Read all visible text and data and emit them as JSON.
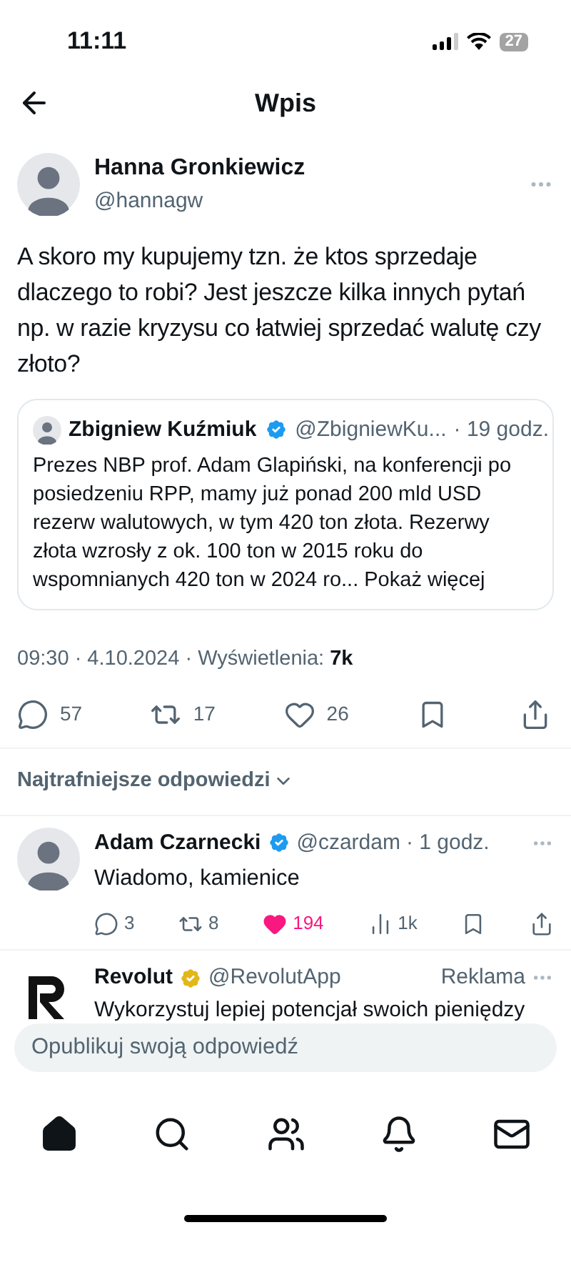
{
  "status_bar": {
    "time": "11:11",
    "battery": "27"
  },
  "header": {
    "title": "Wpis"
  },
  "post": {
    "author": "Hanna Gronkiewicz",
    "handle": "@hannagw",
    "text": "A skoro my kupujemy tzn. że ktos sprzedaje dlaczego to robi? Jest jeszcze kilka innych pytań np. w razie kryzysu co łatwiej sprzedać walutę czy złoto?",
    "quote": {
      "author": "Zbigniew Kuźmiuk",
      "verified": true,
      "handle": "@ZbigniewKu...",
      "time": "· 19 godz.",
      "text": "Prezes NBP prof. Adam Glapiński, na konferencji po posiedzeniu RPP, mamy już ponad 200 mld USD rezerw walutowych, w tym 420 ton złota. Rezerwy złota wzrosły z ok. 100 ton w 2015 roku do wspomnianych 420 ton w 2024 ro...",
      "more": "Pokaż więcej"
    },
    "meta": "09:30 · 4.10.2024 · Wyświetlenia: **7k**",
    "actions": [
      {
        "kind": "reply",
        "count": "57"
      },
      {
        "kind": "repost",
        "count": "17"
      },
      {
        "kind": "like",
        "count": "26",
        "liked": false
      },
      {
        "kind": "bookmark"
      },
      {
        "kind": "share"
      }
    ]
  },
  "sort": {
    "label": "Najtrafniejsze odpowiedzi"
  },
  "replies": [
    {
      "author": "Adam Czarnecki",
      "verified": true,
      "color": "#1d9bf0",
      "handle": "@czardam",
      "time": "· 1 godz.",
      "text": "Wiadomo, kamienice",
      "actions": [
        {
          "kind": "reply",
          "count": "3"
        },
        {
          "kind": "repost",
          "count": "8"
        },
        {
          "kind": "like",
          "count": "194",
          "liked": true
        },
        {
          "kind": "views",
          "count": "1k"
        },
        {
          "kind": "bookmark"
        },
        {
          "kind": "share"
        }
      ]
    },
    {
      "author": "Revolut",
      "verified": true,
      "color": "#e2b719",
      "handle": "@RevolutApp",
      "badge": "Reklama",
      "text": "Wykorzystuj lepiej potencjał swoich pieniędzy"
    }
  ],
  "compose": {
    "placeholder": "Opublikuj swoją odpowiedź"
  },
  "nav": [
    {
      "kind": "home",
      "selected": true
    },
    {
      "kind": "search",
      "selected": false
    },
    {
      "kind": "communities",
      "selected": false
    },
    {
      "kind": "notifications",
      "selected": false
    },
    {
      "kind": "messages",
      "selected": false
    }
  ]
}
